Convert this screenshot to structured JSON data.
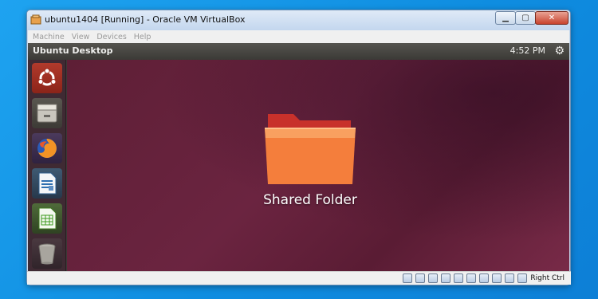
{
  "window": {
    "title": "ubuntu1404 [Running] - Oracle VM VirtualBox",
    "minimize_glyph": "▁",
    "maximize_glyph": "▢",
    "close_glyph": "✕"
  },
  "menubar": {
    "items": [
      "Machine",
      "View",
      "Devices",
      "Help"
    ]
  },
  "ubuntu_panel": {
    "title": "Ubuntu Desktop",
    "clock": "4:52 PM",
    "gear_glyph": "⚙"
  },
  "launcher": {
    "items": [
      "dash-home",
      "files",
      "firefox",
      "libreoffice-writer",
      "libreoffice-calc",
      "trash"
    ]
  },
  "desktop": {
    "folder_label": "Shared Folder"
  },
  "statusbar": {
    "host_key": "Right Ctrl"
  },
  "colors": {
    "desktop_bg": "#5e1f36",
    "launcher_bg": "#3f2a33",
    "folder_orange": "#f47e3c",
    "folder_tab": "#c8312b",
    "close_button": "#c8432e"
  }
}
